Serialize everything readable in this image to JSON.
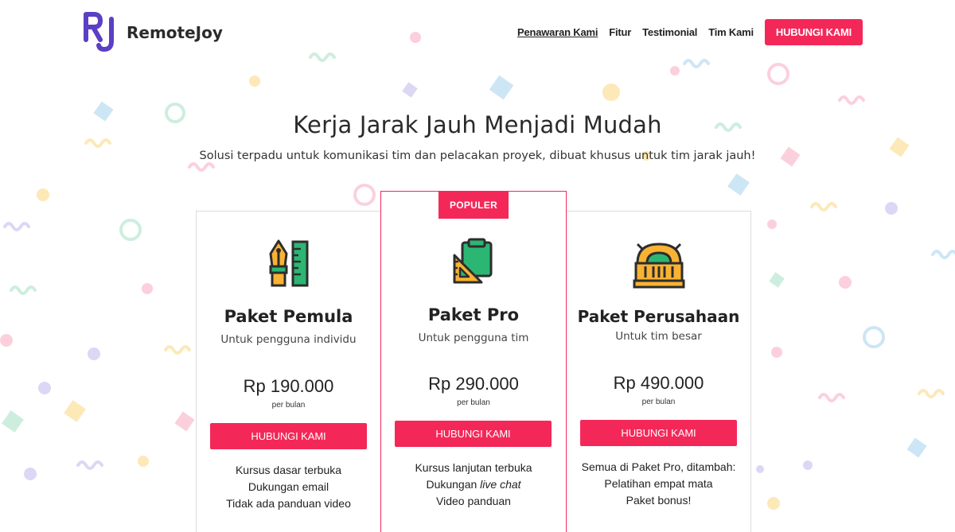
{
  "brand": {
    "name": "RemoteJoy",
    "logo_letters": "RJ",
    "logo_color": "#5b3fc4"
  },
  "nav": {
    "items": [
      {
        "label": "Penawaran Kami",
        "active": true
      },
      {
        "label": "Fitur",
        "active": false
      },
      {
        "label": "Testimonial",
        "active": false
      },
      {
        "label": "Tim Kami",
        "active": false
      }
    ],
    "cta_label": "HUBUNGI KAMI"
  },
  "hero": {
    "title": "Kerja Jarak Jauh Menjadi Mudah",
    "subtitle": "Solusi terpadu untuk komunikasi tim dan pelacakan proyek, dibuat khusus untuk tim jarak jauh!"
  },
  "plans": [
    {
      "icon": "pen-ruler-icon",
      "name": "Paket Pemula",
      "audience": "Untuk pengguna individu",
      "price": "Rp 190.000",
      "period": "per bulan",
      "button": "HUBUNGI KAMI",
      "features": [
        "Kursus dasar terbuka",
        "Dukungan email",
        "Tidak ada panduan video"
      ]
    },
    {
      "badge": "POPULER",
      "icon": "clipboard-set-square-icon",
      "name": "Paket Pro",
      "audience": "Untuk pengguna tim",
      "price": "Rp 290.000",
      "period": "per bulan",
      "button": "HUBUNGI KAMI",
      "features_intro": "Kursus lanjutan terbuka",
      "feature_2_prefix": "Dukungan ",
      "feature_2_em": "live chat",
      "features_last": "Video panduan"
    },
    {
      "icon": "building-icon",
      "name": "Paket Perusahaan",
      "audience": "Untuk tim besar",
      "price": "Rp 490.000",
      "period": "per bulan",
      "button": "HUBUNGI KAMI",
      "features": [
        "Semua di Paket Pro, ditambah:",
        "Pelatihan empat mata",
        "Paket bonus!"
      ]
    }
  ],
  "colors": {
    "accent": "#f42858",
    "text": "#222222",
    "card_border": "#dcdcdc"
  }
}
